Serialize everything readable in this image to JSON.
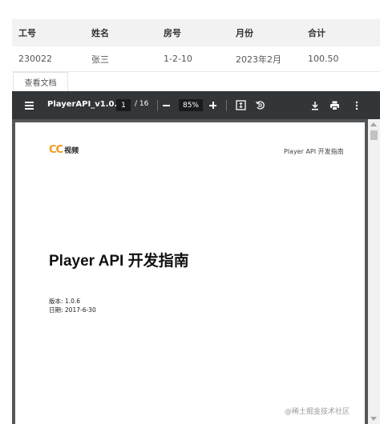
{
  "table": {
    "headers": [
      "工号",
      "姓名",
      "房号",
      "月份",
      "合计"
    ],
    "rows": [
      [
        "230022",
        "张三",
        "1-2-10",
        "2023年2月",
        "100.50"
      ]
    ]
  },
  "tab": {
    "label": "查看文档"
  },
  "viewer": {
    "toolbar": {
      "doc_title": "PlayerAPI_v1.0....",
      "current_page": "1",
      "page_total": "/ 16",
      "zoom": "85%",
      "icons": [
        "menu-icon",
        "minus-icon",
        "plus-icon",
        "fit-page-icon",
        "rotate-icon",
        "download-icon",
        "print-icon",
        "more-vert-icon"
      ]
    },
    "page": {
      "logo_cc": "CC",
      "logo_text": "视频",
      "header_right": "Player API 开发指南",
      "title": "Player API 开发指南",
      "version": "版本: 1.0.6",
      "date": "日期: 2017-6-30"
    }
  },
  "watermark": "@稀土掘金技术社区",
  "colors": {
    "toolbar": "#323639",
    "viewer_bg": "#525659",
    "logo_accent": "#f29a1c",
    "table_header": "#f2f2f2"
  }
}
